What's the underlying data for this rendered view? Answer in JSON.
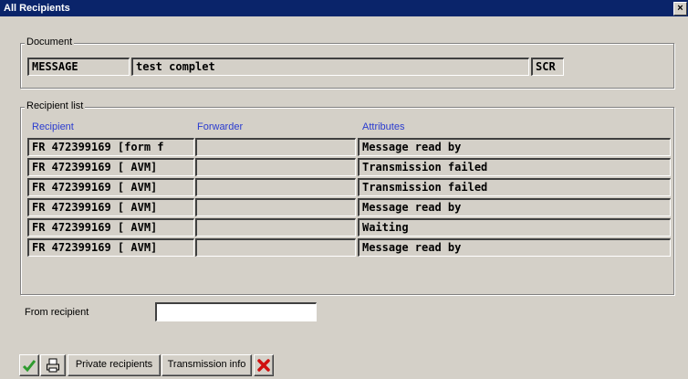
{
  "window": {
    "title": "All Recipients",
    "close_glyph": "×"
  },
  "document": {
    "label": "Document",
    "type": "MESSAGE",
    "subject": "test complet",
    "code": "SCR"
  },
  "recipient_list": {
    "label": "Recipient list",
    "columns": [
      "Recipient",
      "Forwarder",
      "Attributes"
    ],
    "rows": [
      {
        "recipient": "FR 472399169 [form f",
        "forwarder": "",
        "attributes": "Message read by"
      },
      {
        "recipient": "FR 472399169 [ AVM]",
        "forwarder": "",
        "attributes": "Transmission failed"
      },
      {
        "recipient": "FR 472399169 [ AVM]",
        "forwarder": "",
        "attributes": "Transmission failed"
      },
      {
        "recipient": "FR 472399169 [ AVM]",
        "forwarder": "",
        "attributes": "Message read by"
      },
      {
        "recipient": "FR 472399169 [ AVM]",
        "forwarder": "",
        "attributes": "Waiting"
      },
      {
        "recipient": "FR 472399169 [ AVM]",
        "forwarder": "",
        "attributes": "Message read by"
      }
    ]
  },
  "from_recipient": {
    "label": "From recipient",
    "value": ""
  },
  "toolbar": {
    "confirm_icon": "checkmark-icon",
    "print_icon": "printer-icon",
    "private_label": "Private recipients",
    "transmission_label": "Transmission info",
    "cancel_icon": "red-x-icon"
  },
  "colors": {
    "titlebar": "#0a246a",
    "column_header": "#2a3bd0",
    "confirm": "#2e9b2e",
    "cancel": "#d01010"
  }
}
